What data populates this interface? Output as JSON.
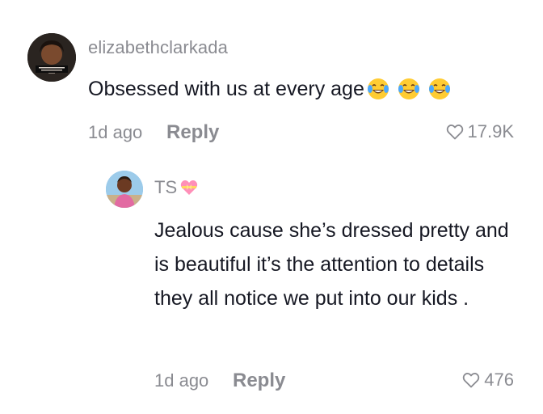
{
  "comments": [
    {
      "username": "elizabethclarkada",
      "text": "Obsessed with us at every age",
      "emojis": [
        "joy-emoji",
        "joy-emoji",
        "joy-emoji"
      ],
      "time": "1d ago",
      "reply_label": "Reply",
      "likes": "17.9K"
    }
  ],
  "replies": [
    {
      "username": "TS",
      "badge_icon": "heart-with-ribbon-emoji",
      "text": "Jealous cause she’s dressed pretty and is beautiful it’s the attention to details they all notice we put into our kids .",
      "time": "1d ago",
      "reply_label": "Reply",
      "likes": "476"
    }
  ],
  "colors": {
    "primary_text": "#161823",
    "secondary_text": "#8a8b91",
    "background": "#ffffff"
  }
}
